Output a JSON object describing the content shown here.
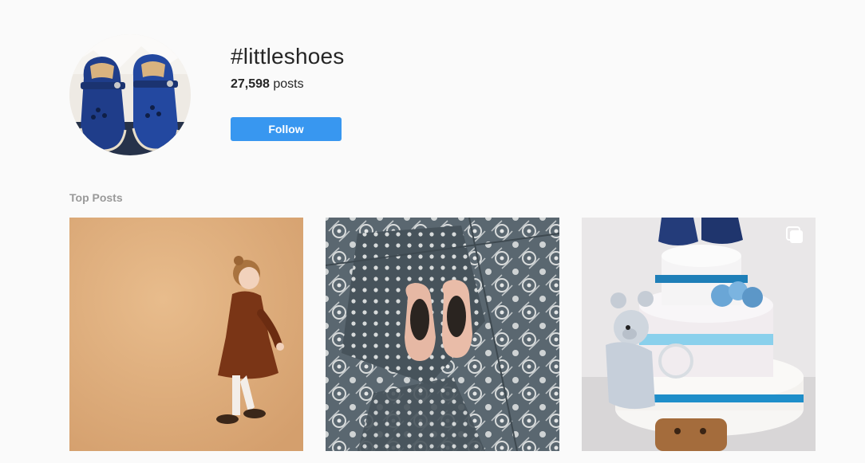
{
  "hashtag": {
    "title": "#littleshoes",
    "post_count": "27,598",
    "post_count_suffix": " posts",
    "follow_label": "Follow"
  },
  "top_posts": {
    "label": "Top Posts",
    "posts": [
      {
        "image": "girl in brown velvet dress and tights with leopard shoes",
        "multiple": false
      },
      {
        "image": "pink ballet slippers on patterned blue tiles",
        "multiple": false
      },
      {
        "image": "diaper cake with teddy bear and baby shoes",
        "multiple": true,
        "icon": "multiple-images-icon"
      }
    ]
  },
  "colors": {
    "background": "#fafafa",
    "follow_button": "#3897f0",
    "label_gray": "#999999"
  }
}
